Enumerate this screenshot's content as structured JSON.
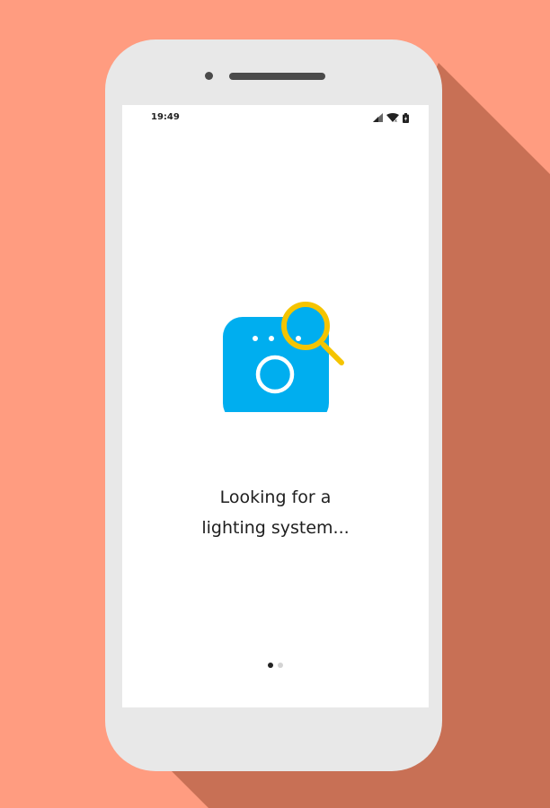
{
  "status_bar": {
    "time": "19:49",
    "icons": [
      "cellular-signal-icon",
      "wifi-icon",
      "battery-charging-icon"
    ]
  },
  "main": {
    "illustration": "bridge-search-icon",
    "message_line1": "Looking for a",
    "message_line2": "lighting system..."
  },
  "pager": {
    "total": 2,
    "active": 1
  },
  "colors": {
    "background": "#FF9C80",
    "shadow": "#C87055",
    "phone_body": "#E8E8E8",
    "screen": "#FFFFFF",
    "bridge_blue": "#00AEEF",
    "magnifier_yellow": "#F5C400"
  }
}
